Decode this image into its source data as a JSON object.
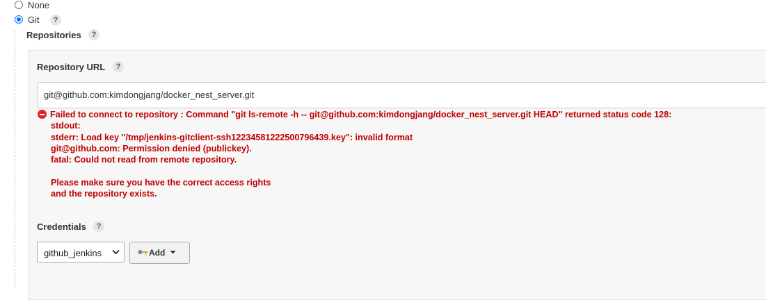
{
  "scm": {
    "options": [
      {
        "label": "None",
        "checked": false
      },
      {
        "label": "Git",
        "checked": true
      }
    ],
    "help_glyph": "?"
  },
  "repositories": {
    "label": "Repositories",
    "repository_url": {
      "label": "Repository URL",
      "value": "git@github.com:kimdongjang/docker_nest_server.git"
    },
    "error": {
      "icon": "error-circle-icon",
      "lines": [
        "Failed to connect to repository : Command \"git ls-remote -h -- git@github.com:kimdongjang/docker_nest_server.git HEAD\" returned status code 128:",
        "stdout:",
        "stderr: Load key \"/tmp/jenkins-gitclient-ssh12234581222500796439.key\": invalid format",
        "git@github.com: Permission denied (publickey).",
        "fatal: Could not read from remote repository.",
        "",
        "Please make sure you have the correct access rights",
        "and the repository exists."
      ],
      "color": "#c00000"
    },
    "credentials": {
      "label": "Credentials",
      "selected": "github_jenkins",
      "add_label": "Add"
    }
  },
  "colors": {
    "accent": "#0075ff",
    "error": "#c00000"
  }
}
